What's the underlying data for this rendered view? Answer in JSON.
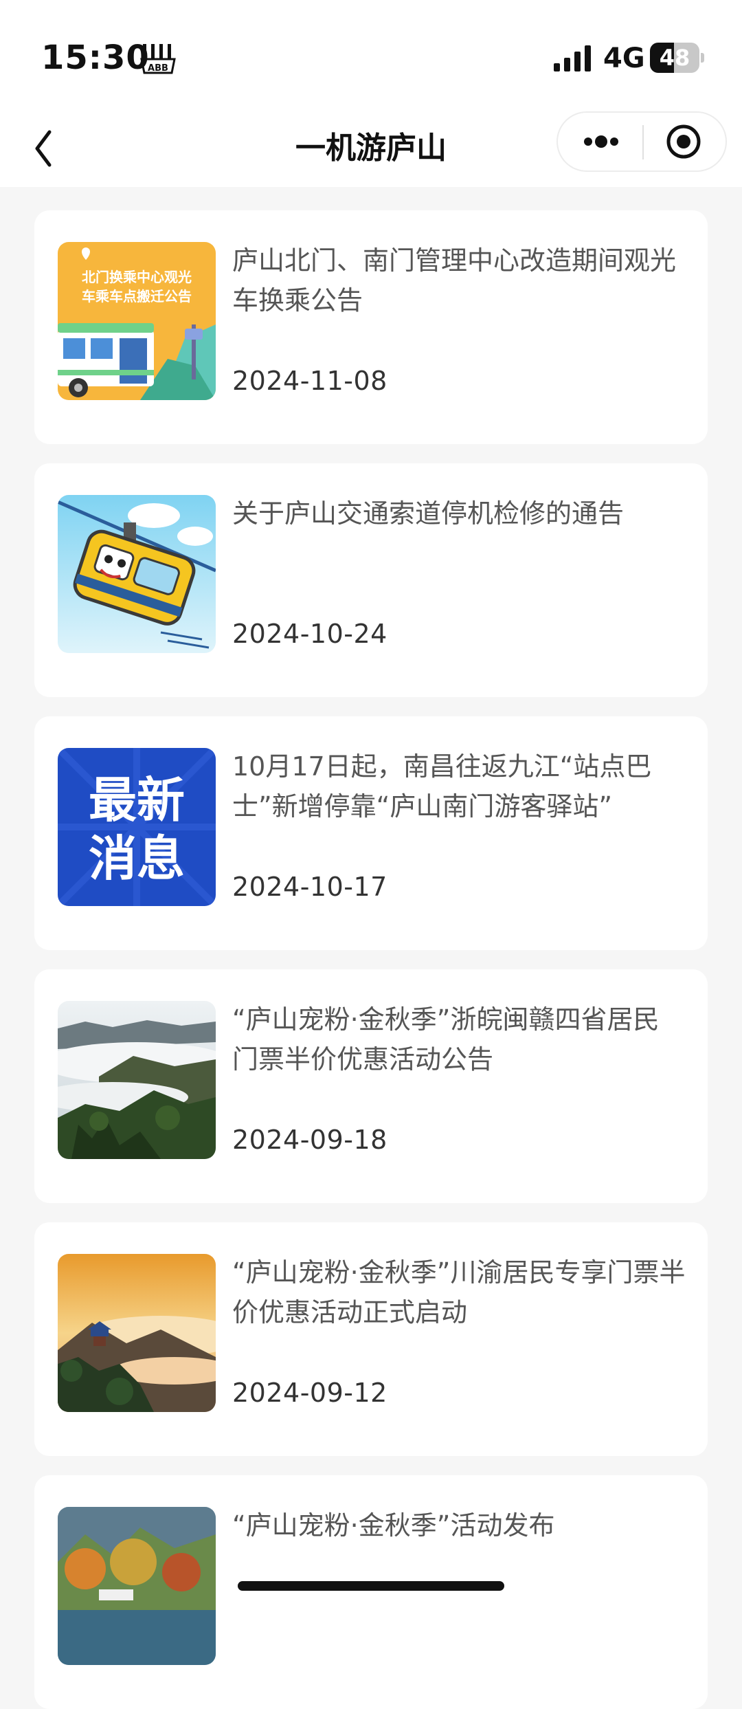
{
  "status_bar": {
    "time": "15:30",
    "network": "4G",
    "battery": "48",
    "battery_level": 0.48
  },
  "nav": {
    "title": "一机游庐山"
  },
  "news": [
    {
      "title": "庐山北门、南门管理中心改造期间观光车换乘公告",
      "date": "2024-11-08",
      "thumb_text_1": "北门换乘中心观光",
      "thumb_text_2": "车乘车点搬迁公告",
      "thumb_icon": "bus-illustration"
    },
    {
      "title": "关于庐山交通索道停机检修的通告",
      "date": "2024-10-24",
      "thumb_icon": "cable-car-illustration"
    },
    {
      "title": "10月17日起，南昌往返九江“站点巴士”新增停靠“庐山南门游客驿站”",
      "date": "2024-10-17",
      "thumb_text_1": "最新",
      "thumb_text_2": "消息",
      "thumb_icon": "latest-news-banner"
    },
    {
      "title": "“庐山宠粉·金秋季”浙皖闽赣四省居民 门票半价优惠活动公告",
      "date": "2024-09-18",
      "thumb_icon": "mountain-cloud-photo"
    },
    {
      "title": "“庐山宠粉·金秋季”川渝居民专享门票半价优惠活动正式启动",
      "date": "2024-09-12",
      "thumb_icon": "sunset-pavilion-photo"
    },
    {
      "title": "“庐山宠粉·金秋季”活动发布",
      "date": "",
      "thumb_icon": "autumn-lake-photo"
    }
  ],
  "colors": {
    "page_bg": "#f6f6f6",
    "card_bg": "#ffffff",
    "news_banner_blue": "#1f4cc4",
    "bus_thumb_orange": "#f7b63c"
  }
}
